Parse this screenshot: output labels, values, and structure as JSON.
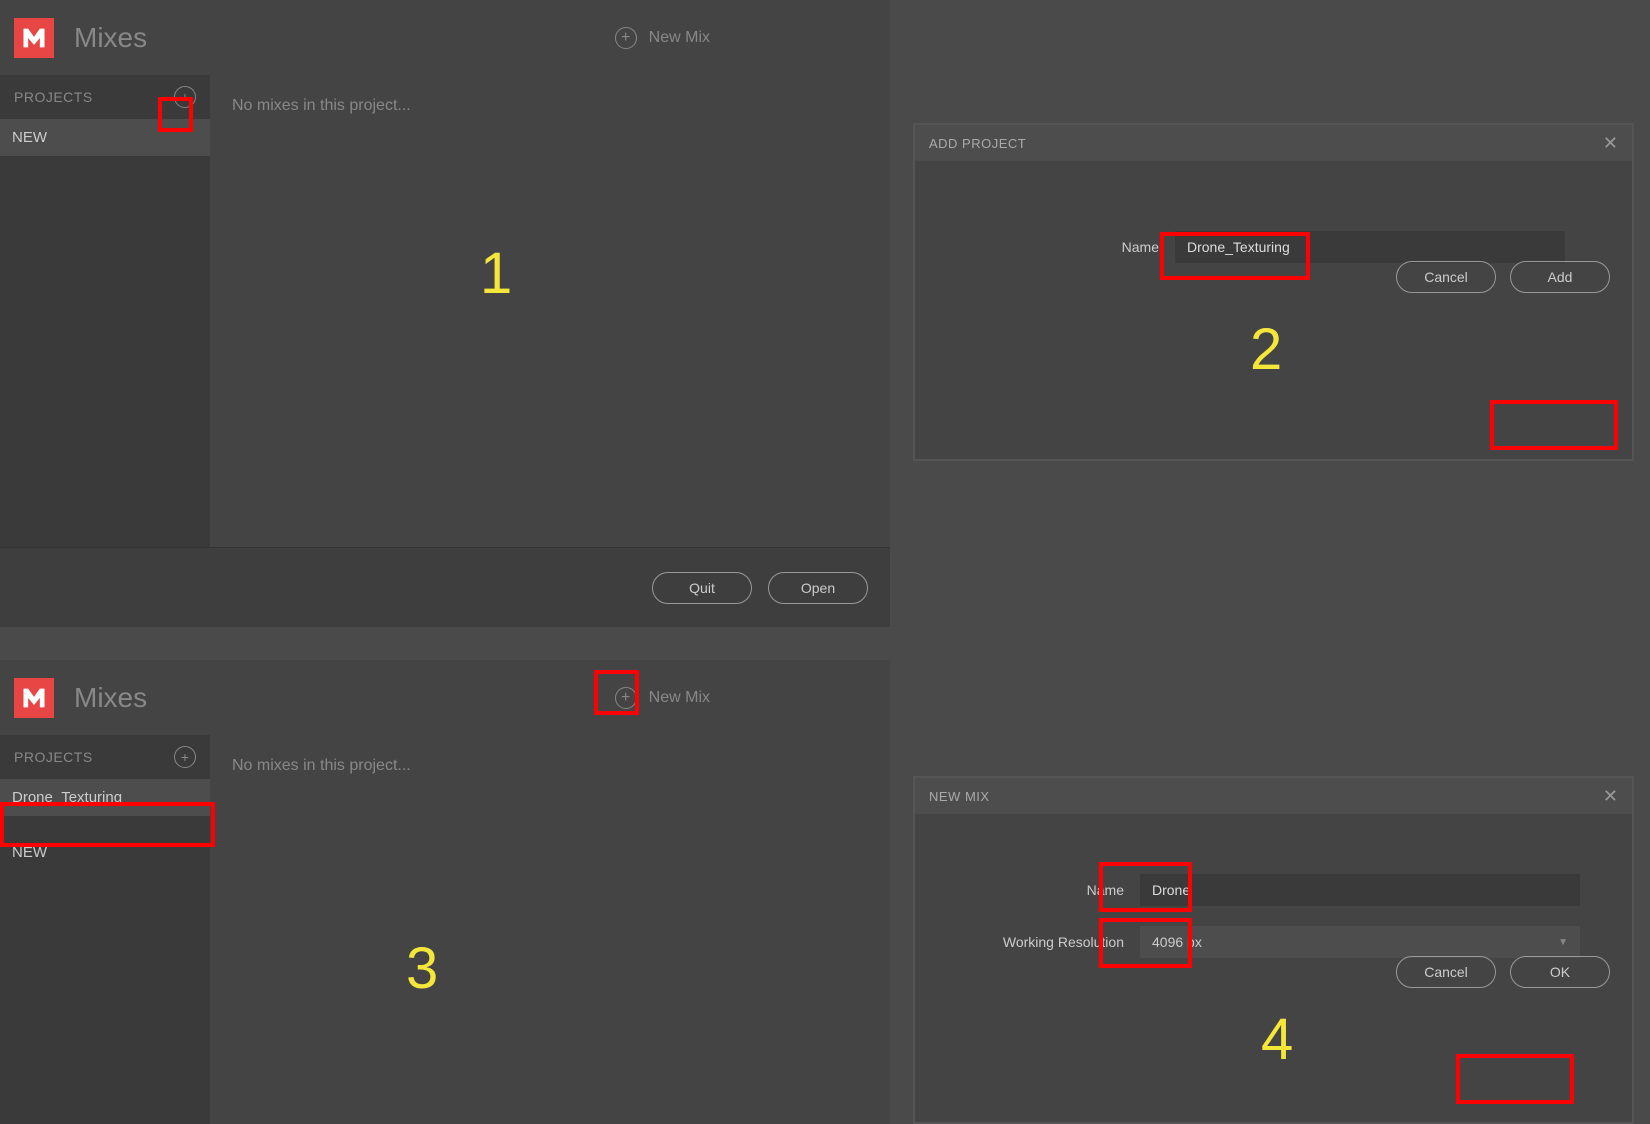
{
  "panel1": {
    "title": "Mixes",
    "newMixLabel": "New Mix",
    "projectsLabel": "PROJECTS",
    "projectSelected": "NEW",
    "emptyMsg": "No mixes in this project...",
    "quitLabel": "Quit",
    "openLabel": "Open",
    "stepNum": "1"
  },
  "panel2": {
    "dialogTitle": "ADD PROJECT",
    "nameLabel": "Name",
    "nameValue": "Drone_Texturing",
    "cancelLabel": "Cancel",
    "addLabel": "Add",
    "stepNum": "2"
  },
  "panel3": {
    "title": "Mixes",
    "newMixLabel": "New Mix",
    "projectsLabel": "PROJECTS",
    "project1": "Drone_Texturing",
    "project2": "NEW",
    "emptyMsg": "No mixes in this project...",
    "stepNum": "3"
  },
  "panel4": {
    "dialogTitle": "NEW MIX",
    "nameLabel": "Name",
    "nameValue": "Drone",
    "resLabel": "Working Resolution",
    "resValue": "4096 px",
    "cancelLabel": "Cancel",
    "okLabel": "OK",
    "stepNum": "4"
  }
}
